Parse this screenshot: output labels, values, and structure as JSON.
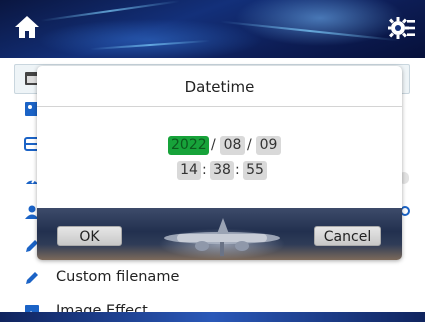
{
  "header": {
    "home_icon": "home-icon",
    "settings_icon": "settings-gear-icon"
  },
  "settings_list": {
    "items": [
      {
        "icon": "calendar-icon",
        "label": ""
      },
      {
        "icon": "image-edit-icon",
        "label": ""
      },
      {
        "icon": "list-icon",
        "label": ""
      },
      {
        "icon": "speed-icon",
        "label": ""
      },
      {
        "icon": "user-icon",
        "label": ""
      },
      {
        "icon": "pencil-icon",
        "label": ""
      },
      {
        "icon": "pencil-icon",
        "label": "Custom filename"
      },
      {
        "icon": "image-icon",
        "label": "Image Effect"
      }
    ]
  },
  "dialog": {
    "title": "Datetime",
    "date": {
      "year": "2022",
      "month": "08",
      "day": "09",
      "separator": "/"
    },
    "time": {
      "hour": "14",
      "minute": "38",
      "second": "55",
      "separator": ":"
    },
    "selected_field": "year",
    "ok_label": "OK",
    "cancel_label": "Cancel"
  },
  "colors": {
    "header_blue": "#13307a",
    "selected_field_green": "#17a33a",
    "icon_blue": "#1b63c6"
  }
}
